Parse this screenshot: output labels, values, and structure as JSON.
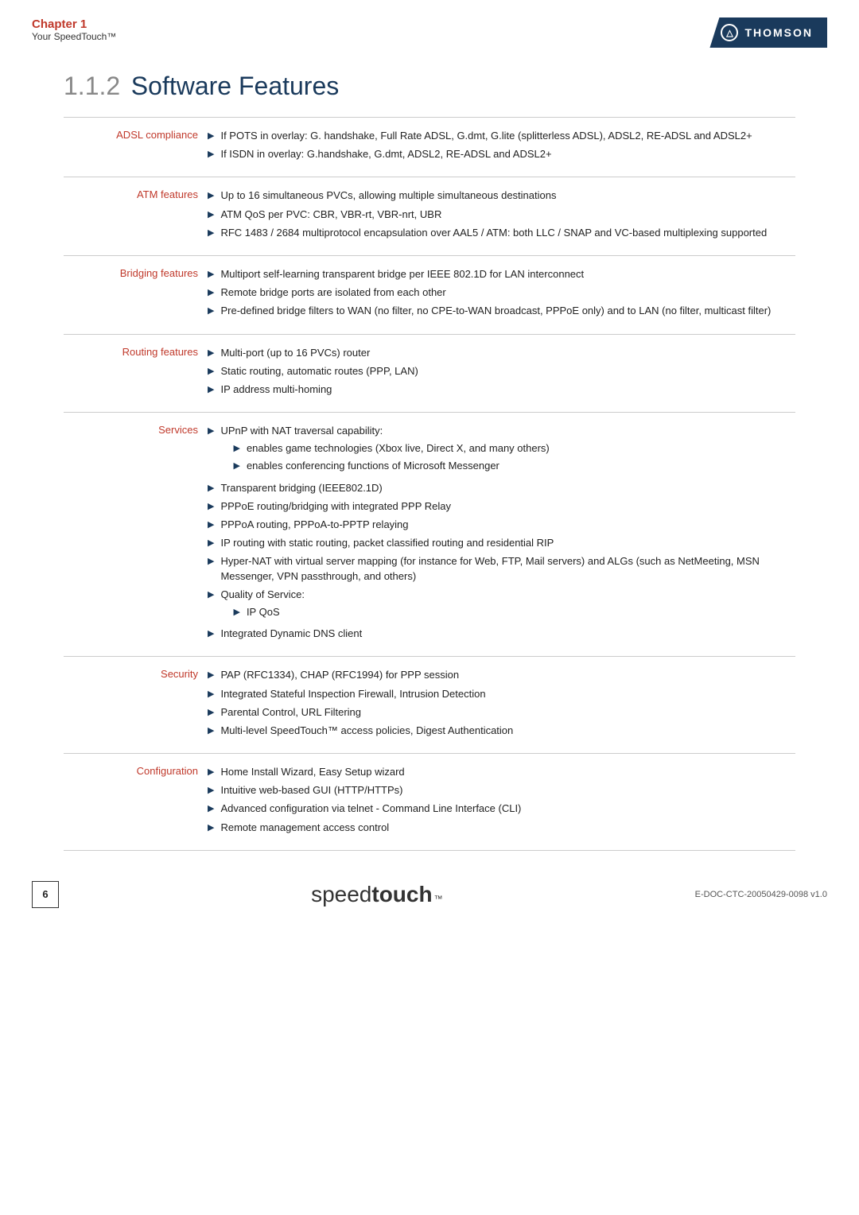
{
  "header": {
    "chapter": "Chapter 1",
    "chapter_sub": "Your SpeedTouch™",
    "logo_text": "THOMSON",
    "logo_icon": "Ω"
  },
  "section": {
    "number": "1.1.2",
    "title": "Software Features"
  },
  "features": [
    {
      "label": "ADSL compliance",
      "items": [
        {
          "text": "If POTS in overlay: G. handshake, Full Rate ADSL, G.dmt, G.lite (splitterless ADSL), ADSL2, RE-ADSL and ADSL2+"
        },
        {
          "text": "If ISDN in overlay: G.handshake, G.dmt, ADSL2, RE-ADSL and ADSL2+"
        }
      ]
    },
    {
      "label": "ATM features",
      "items": [
        {
          "text": "Up to 16 simultaneous PVCs, allowing multiple simultaneous destinations"
        },
        {
          "text": "ATM QoS per PVC: CBR, VBR-rt, VBR-nrt, UBR"
        },
        {
          "text": "RFC 1483 / 2684 multiprotocol encapsulation over AAL5 / ATM: both LLC / SNAP and VC-based multiplexing supported"
        }
      ]
    },
    {
      "label": "Bridging features",
      "items": [
        {
          "text": "Multiport self-learning transparent bridge per IEEE 802.1D for LAN interconnect"
        },
        {
          "text": "Remote bridge ports are isolated from each other"
        },
        {
          "text": "Pre-defined bridge filters to WAN (no filter, no CPE-to-WAN broadcast, PPPoE only) and to LAN (no filter, multicast filter)"
        }
      ]
    },
    {
      "label": "Routing features",
      "items": [
        {
          "text": "Multi-port (up to 16 PVCs) router"
        },
        {
          "text": "Static routing, automatic routes (PPP, LAN)"
        },
        {
          "text": "IP address multi-homing"
        }
      ]
    },
    {
      "label": "Services",
      "items": [
        {
          "text": "UPnP with NAT traversal capability:",
          "sub": [
            "enables game technologies (Xbox live, Direct X, and many others)",
            "enables conferencing functions of Microsoft Messenger"
          ]
        },
        {
          "text": "Transparent bridging (IEEE802.1D)"
        },
        {
          "text": "PPPoE routing/bridging with integrated PPP Relay"
        },
        {
          "text": "PPPoA routing, PPPoA-to-PPTP relaying"
        },
        {
          "text": "IP routing with static routing, packet classified routing and residential RIP"
        },
        {
          "text": "Hyper-NAT with virtual server mapping (for instance for Web, FTP, Mail servers) and ALGs (such as NetMeeting, MSN Messenger, VPN passthrough, and others)"
        },
        {
          "text": "Quality of Service:",
          "sub": [
            "IP QoS"
          ]
        },
        {
          "text": "Integrated Dynamic DNS client"
        }
      ]
    },
    {
      "label": "Security",
      "items": [
        {
          "text": "PAP (RFC1334), CHAP (RFC1994) for PPP session"
        },
        {
          "text": "Integrated Stateful Inspection Firewall, Intrusion Detection"
        },
        {
          "text": "Parental Control, URL Filtering"
        },
        {
          "text": "Multi-level SpeedTouch™ access policies, Digest Authentication"
        }
      ]
    },
    {
      "label": "Configuration",
      "items": [
        {
          "text": "Home Install Wizard, Easy Setup wizard"
        },
        {
          "text": "Intuitive web-based GUI (HTTP/HTTPs)"
        },
        {
          "text": "Advanced configuration via telnet - Command Line Interface (CLI)"
        },
        {
          "text": "Remote management access control"
        }
      ]
    }
  ],
  "footer": {
    "page_number": "6",
    "logo_speed": "speed",
    "logo_touch": "touch",
    "logo_tm": "™",
    "doc_number": "E-DOC-CTC-20050429-0098 v1.0"
  }
}
